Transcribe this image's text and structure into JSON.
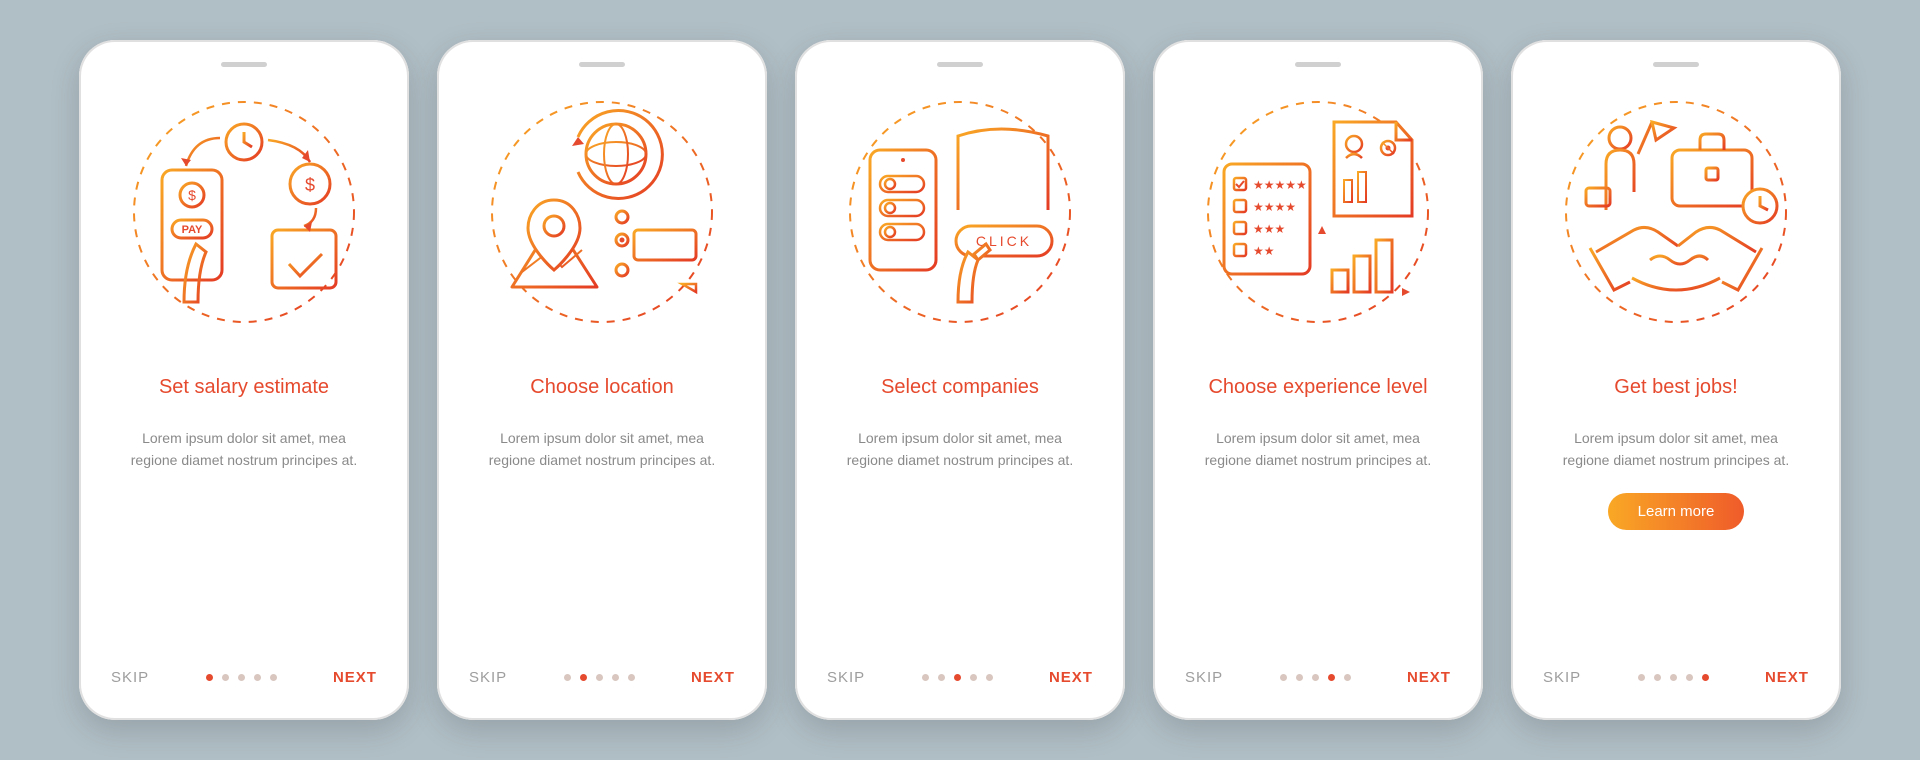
{
  "colors": {
    "accent": "#e64a2e",
    "gradientStart": "#f9a825",
    "gradientEnd": "#ef5b2a"
  },
  "nav": {
    "skip": "SKIP",
    "next": "NEXT"
  },
  "cta": "Learn more",
  "illustrationLabel": "CLICK",
  "screens": [
    {
      "title": "Set salary estimate",
      "desc": "Lorem ipsum dolor sit amet, mea regione diamet nostrum principes at.",
      "activeDot": 0,
      "hasCta": false
    },
    {
      "title": "Choose location",
      "desc": "Lorem ipsum dolor sit amet, mea regione diamet nostrum principes at.",
      "activeDot": 1,
      "hasCta": false
    },
    {
      "title": "Select companies",
      "desc": "Lorem ipsum dolor sit amet, mea regione diamet nostrum principes at.",
      "activeDot": 2,
      "hasCta": false
    },
    {
      "title": "Choose experience level",
      "desc": "Lorem ipsum dolor sit amet, mea regione diamet nostrum principes at.",
      "activeDot": 3,
      "hasCta": false
    },
    {
      "title": "Get best jobs!",
      "desc": "Lorem ipsum dolor sit amet, mea regione diamet nostrum principes at.",
      "activeDot": 4,
      "hasCta": true
    }
  ]
}
